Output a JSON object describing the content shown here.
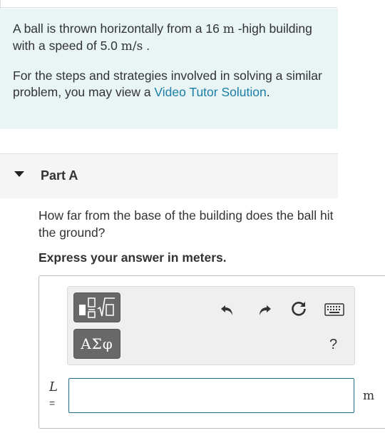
{
  "intro": {
    "line1_a": "A ball is thrown horizontally from a 16 ",
    "height_unit": "m",
    "line1_b": " -high building with a speed of 5.0 ",
    "speed_unit": "m/s",
    "line1_c": " .",
    "line2_a": "For the steps and strategies involved in solving a similar problem, you may view a ",
    "link_text": "Video Tutor Solution",
    "line2_b": "."
  },
  "part": {
    "title": "Part A"
  },
  "question": {
    "text": "How far from the base of the building does the ball hit the ground?",
    "instruction": "Express your answer in meters."
  },
  "toolbar": {
    "symbols_label": "ΑΣφ",
    "help_label": "?",
    "icons": [
      "templates-icon",
      "undo-icon",
      "redo-icon",
      "reset-icon",
      "keyboard-icon"
    ]
  },
  "answer": {
    "variable": "L",
    "equals": "=",
    "value": "",
    "unit": "m"
  },
  "colors": {
    "intro_bg": "#e9f4f4",
    "link": "#1a7ea8",
    "input_border": "#1f6f88",
    "template_button": "#686868"
  }
}
